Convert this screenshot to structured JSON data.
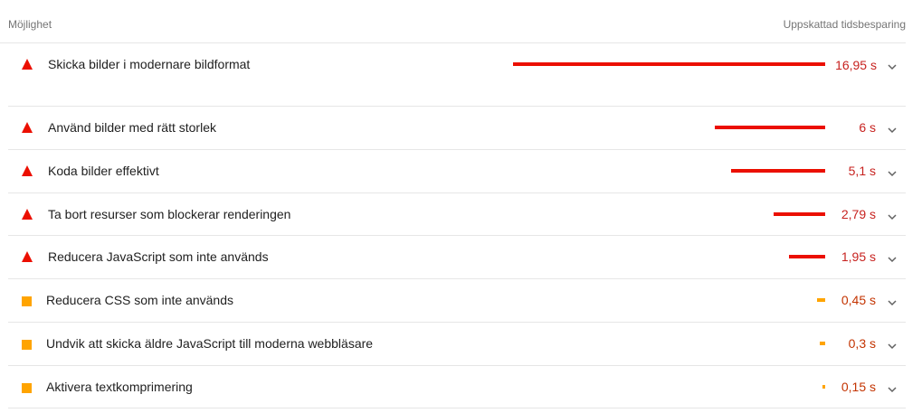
{
  "header": {
    "left_label": "Möjlighet",
    "right_label": "Uppskattad tidsbesparing"
  },
  "colors": {
    "fail": "#eb0f00",
    "fail_text": "#c7221f",
    "average": "#ffa400",
    "average_text": "#c33300",
    "divider": "#e6e6e6"
  },
  "max_savings_seconds": 16.95,
  "opportunities": [
    {
      "label": "Skicka bilder i modernare bildformat",
      "value": "16,95 s",
      "seconds": 16.95,
      "rating": "fail"
    },
    {
      "label": "Använd bilder med rätt storlek",
      "value": "6 s",
      "seconds": 6,
      "rating": "fail"
    },
    {
      "label": "Koda bilder effektivt",
      "value": "5,1 s",
      "seconds": 5.1,
      "rating": "fail"
    },
    {
      "label": "Ta bort resurser som blockerar renderingen",
      "value": "2,79 s",
      "seconds": 2.79,
      "rating": "fail"
    },
    {
      "label": "Reducera JavaScript som inte används",
      "value": "1,95 s",
      "seconds": 1.95,
      "rating": "fail"
    },
    {
      "label": "Reducera CSS som inte används",
      "value": "0,45 s",
      "seconds": 0.45,
      "rating": "average"
    },
    {
      "label": "Undvik att skicka äldre JavaScript till moderna webbläsare",
      "value": "0,3 s",
      "seconds": 0.3,
      "rating": "average"
    },
    {
      "label": "Aktivera textkomprimering",
      "value": "0,15 s",
      "seconds": 0.15,
      "rating": "average"
    }
  ],
  "icons": {
    "fail": "triangle-warning-icon",
    "average": "square-average-icon",
    "expand": "chevron-down-icon"
  }
}
